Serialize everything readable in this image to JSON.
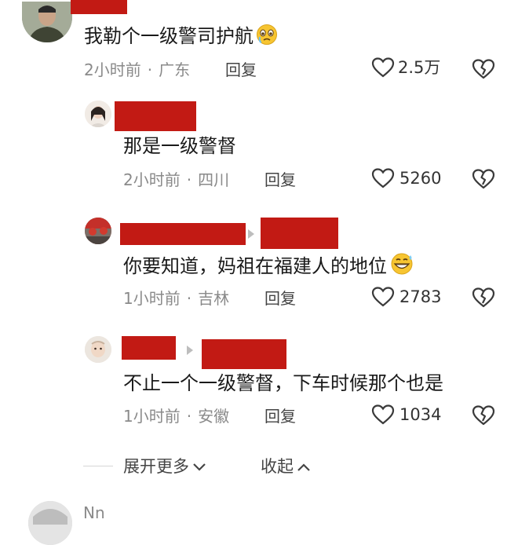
{
  "comments": [
    {
      "text": "我勒个一级警司护航",
      "time": "2小时前",
      "location": "广东",
      "reply_label": "回复",
      "likes": "2.5万"
    },
    {
      "text": "那是一级警督",
      "time": "2小时前",
      "location": "四川",
      "reply_label": "回复",
      "likes": "5260"
    },
    {
      "text": "你要知道，妈祖在福建人的地位",
      "time": "1小时前",
      "location": "吉林",
      "reply_label": "回复",
      "likes": "2783"
    },
    {
      "text": "不止一个一级警督，下车时候那个也是",
      "time": "1小时前",
      "location": "安徽",
      "reply_label": "回复",
      "likes": "1034"
    }
  ],
  "footer": {
    "expand_label": "展开更多",
    "collapse_label": "收起"
  },
  "next_comment": {
    "username_partial": "Nn"
  },
  "colors": {
    "redaction": "#c21a14",
    "meta_gray": "#8a8a8a",
    "emoji_yellow": "#f7c531"
  }
}
